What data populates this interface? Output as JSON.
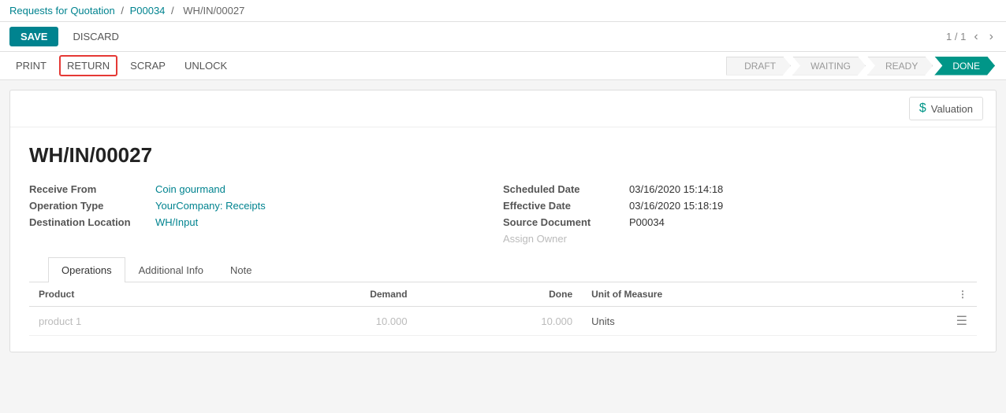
{
  "breadcrumb": {
    "root": "Requests for Quotation",
    "sep1": "/",
    "p00034": "P00034",
    "sep2": "/",
    "current": "WH/IN/00027"
  },
  "toolbar": {
    "save_label": "SAVE",
    "discard_label": "DISCARD",
    "nav_count": "1 / 1"
  },
  "actions": {
    "print": "PRINT",
    "return": "RETURN",
    "scrap": "SCRAP",
    "unlock": "UNLOCK"
  },
  "status_steps": [
    {
      "label": "DRAFT",
      "active": false
    },
    {
      "label": "WAITING",
      "active": false
    },
    {
      "label": "READY",
      "active": false
    },
    {
      "label": "DONE",
      "active": true
    }
  ],
  "valuation_btn": "Valuation",
  "document": {
    "title": "WH/IN/00027",
    "fields_left": [
      {
        "label": "Receive From",
        "value": "Coin gourmand",
        "link": true
      },
      {
        "label": "Operation Type",
        "value": "YourCompany: Receipts",
        "link": true
      },
      {
        "label": "Destination Location",
        "value": "WH/Input",
        "link": true
      }
    ],
    "fields_right": [
      {
        "label": "Scheduled Date",
        "value": "03/16/2020 15:14:18",
        "link": false
      },
      {
        "label": "Effective Date",
        "value": "03/16/2020 15:18:19",
        "link": false
      },
      {
        "label": "Source Document",
        "value": "P00034",
        "link": false
      }
    ],
    "assign_owner": "Assign Owner"
  },
  "tabs": [
    {
      "label": "Operations",
      "active": true
    },
    {
      "label": "Additional Info",
      "active": false
    },
    {
      "label": "Note",
      "active": false
    }
  ],
  "table": {
    "headers": [
      {
        "label": "Product",
        "align": "left"
      },
      {
        "label": "Demand",
        "align": "right"
      },
      {
        "label": "Done",
        "align": "right"
      },
      {
        "label": "Unit of Measure",
        "align": "left"
      },
      {
        "label": "",
        "align": "right"
      }
    ],
    "rows": [
      {
        "product": "product 1",
        "demand": "10.000",
        "done": "10.000",
        "unit": "Units"
      }
    ]
  },
  "icons": {
    "dollar": "$",
    "prev": "‹",
    "next": "›",
    "menu": "⋮",
    "list": "≡"
  }
}
